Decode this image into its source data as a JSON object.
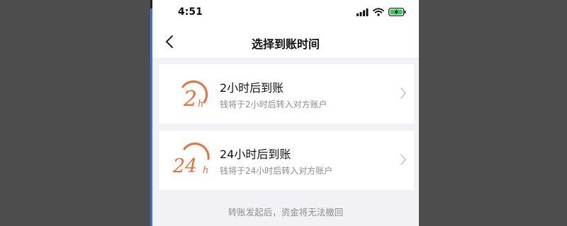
{
  "status_bar": {
    "time": "4:51",
    "icons": [
      "signal-icon",
      "wifi-icon",
      "battery-charging-icon"
    ]
  },
  "nav": {
    "back_icon": "chevron-left-icon",
    "title": "选择到账时间"
  },
  "options": [
    {
      "badge_number": "2",
      "badge_unit": "h",
      "label": "2小时后到账",
      "description": "钱将于2小时后转入对方账户",
      "chevron_icon": "chevron-right-icon"
    },
    {
      "badge_number": "24",
      "badge_unit": "h",
      "label": "24小时后到账",
      "description": "钱将于24小时后转入对方账户",
      "chevron_icon": "chevron-right-icon"
    }
  ],
  "footer_note": "转账发起后，资金将无法撤回",
  "colors": {
    "accent_orange": "#e8703a",
    "background": "#f2f2f6",
    "side_border": "#3f72d8"
  }
}
